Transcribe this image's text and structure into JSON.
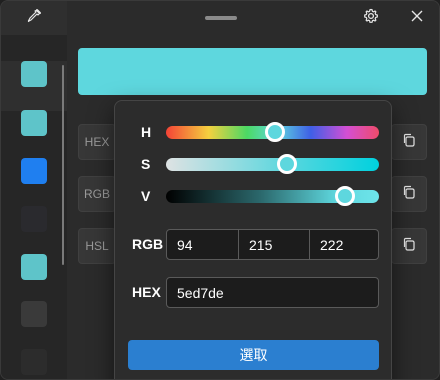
{
  "titlebar": {
    "pick_icon": "eyedropper-icon",
    "settings_icon": "gear-icon",
    "close_icon": "close-icon"
  },
  "history": {
    "swatches": [
      "#5ec4c9",
      "#5ec4c9",
      "#1f7ff0",
      "#2a2a2e",
      "#5ec4c9",
      "#3a3a3a",
      "#2c2c2c"
    ]
  },
  "main": {
    "preview_color": "#5ed7de",
    "formats": [
      {
        "label": "HEX",
        "copy_icon": "copy-icon"
      },
      {
        "label": "RGB",
        "copy_icon": "copy-icon"
      },
      {
        "label": "HSL",
        "copy_icon": "copy-icon"
      }
    ]
  },
  "editor": {
    "sliders": [
      {
        "label": "H",
        "value_fraction": 0.51
      },
      {
        "label": "S",
        "value_fraction": 0.57
      },
      {
        "label": "V",
        "value_fraction": 0.84
      }
    ],
    "rgb_label": "RGB",
    "rgb": {
      "r": "94",
      "g": "215",
      "b": "222"
    },
    "hex_label": "HEX",
    "hex": "5ed7de",
    "select_label": "選取",
    "accent": "#2b7fd0"
  }
}
